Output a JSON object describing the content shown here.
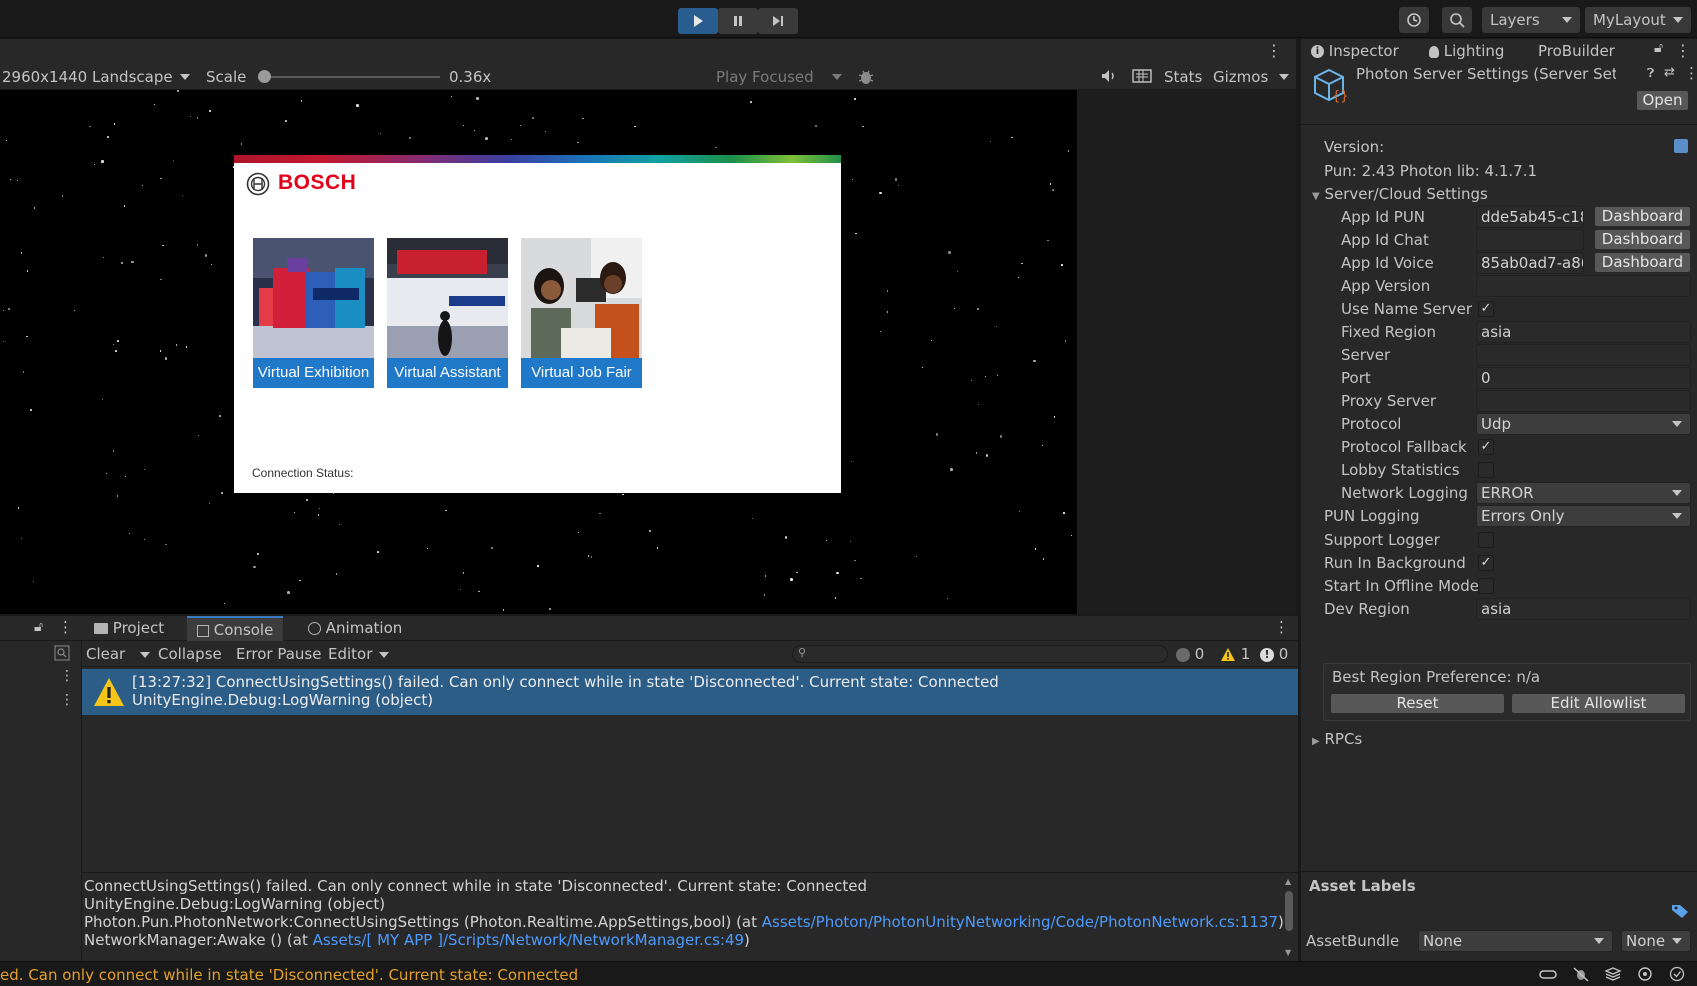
{
  "toolbar": {
    "layers_label": "Layers",
    "layout_label": "MyLayout"
  },
  "game": {
    "resolution": "2960x1440 Landscape",
    "scale_label": "Scale",
    "scale_value": "0.36x",
    "scale_slider_fraction": 0.0,
    "play_mode": "Play Focused",
    "stats_label": "Stats",
    "gizmos_label": "Gizmos"
  },
  "bosch": {
    "brand": "BOSCH",
    "tiles": [
      {
        "label": "Virtual Exhibition"
      },
      {
        "label": "Virtual Assistant"
      },
      {
        "label": "Virtual Job Fair"
      }
    ],
    "connection_status": "Connection Status:"
  },
  "inspector": {
    "tabs": [
      "Inspector",
      "Lighting",
      "ProBuilder"
    ],
    "title": "Photon Server Settings (Server Set",
    "open_label": "Open",
    "version_label": "Version:",
    "version_value": "Pun: 2.43 Photon lib: 4.1.7.1",
    "section_server": "Server/Cloud Settings",
    "app_id_pun_label": "App Id PUN",
    "app_id_pun_value": "dde5ab45-c18",
    "app_id_chat_label": "App Id Chat",
    "app_id_chat_value": "",
    "app_id_voice_label": "App Id Voice",
    "app_id_voice_value": "85ab0ad7-a86",
    "dashboard_label": "Dashboard",
    "app_version_label": "App Version",
    "app_version_value": "",
    "use_name_server_label": "Use Name Server",
    "fixed_region_label": "Fixed Region",
    "fixed_region_value": "asia",
    "server_label": "Server",
    "server_value": "",
    "port_label": "Port",
    "port_value": "0",
    "proxy_server_label": "Proxy Server",
    "proxy_server_value": "",
    "protocol_label": "Protocol",
    "protocol_value": "Udp",
    "protocol_fallback_label": "Protocol Fallback",
    "lobby_statistics_label": "Lobby Statistics",
    "network_logging_label": "Network Logging",
    "network_logging_value": "ERROR",
    "pun_logging_label": "PUN Logging",
    "pun_logging_value": "Errors Only",
    "support_logger_label": "Support Logger",
    "run_in_background_label": "Run In Background",
    "start_offline_label": "Start In Offline Mode",
    "dev_region_label": "Dev Region",
    "dev_region_value": "asia",
    "best_region_label": "Best Region Preference: n/a",
    "reset_label": "Reset",
    "edit_allowlist_label": "Edit Allowlist",
    "rpcs_label": "RPCs",
    "asset_labels": "Asset Labels",
    "assetbundle_label": "AssetBundle",
    "assetbundle_value": "None",
    "assetbundle_variant": "None"
  },
  "console": {
    "tabs": [
      "Project",
      "Console",
      "Animation"
    ],
    "clear_label": "Clear",
    "collapse_label": "Collapse",
    "error_pause_label": "Error Pause",
    "editor_label": "Editor",
    "count_info": "0",
    "count_warn": "1",
    "count_error": "0",
    "entry_line1": "[13:27:32] ConnectUsingSettings() failed. Can only connect while in state 'Disconnected'. Current state: Connected",
    "entry_line2": "UnityEngine.Debug:LogWarning (object)",
    "detail_line1": "ConnectUsingSettings() failed. Can only connect while in state 'Disconnected'. Current state: Connected",
    "detail_line2": "UnityEngine.Debug:LogWarning (object)",
    "detail_line3_prefix": "Photon.Pun.PhotonNetwork:ConnectUsingSettings (Photon.Realtime.AppSettings,bool) (at ",
    "detail_line3_link": "Assets/Photon/PhotonUnityNetworking/Code/PhotonNetwork.cs:1137",
    "detail_line3_suffix": ")",
    "detail_line4_prefix": "NetworkManager:Awake () (at ",
    "detail_line4_link": "Assets/[ MY APP ]/Scripts/Network/NetworkManager.cs:49",
    "detail_line4_suffix": ")"
  },
  "status": {
    "message": "ed. Can only connect while in state 'Disconnected'. Current state: Connected"
  },
  "colors": {
    "accent_blue": "#2c5d87",
    "bosch_red": "#e2001a",
    "bosch_tile_blue": "#1f78c8",
    "warning_yellow": "#f5c518",
    "link_blue": "#4c9bff"
  }
}
